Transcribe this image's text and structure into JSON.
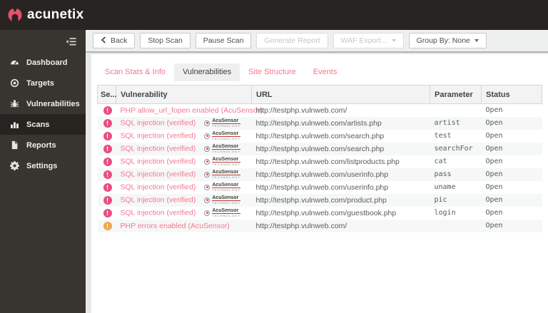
{
  "brand": {
    "logo_text": "acunetix"
  },
  "colors": {
    "accent_pink": "#e8506e",
    "link_pink": "#f2788f",
    "severity_high": "#e84d82",
    "severity_medium": "#eda54e"
  },
  "sidebar": {
    "items": [
      {
        "label": "Dashboard",
        "icon": "dashboard-icon",
        "active": false
      },
      {
        "label": "Targets",
        "icon": "targets-icon",
        "active": false
      },
      {
        "label": "Vulnerabilities",
        "icon": "vulnerabilities-icon",
        "active": false
      },
      {
        "label": "Scans",
        "icon": "scans-icon",
        "active": true
      },
      {
        "label": "Reports",
        "icon": "reports-icon",
        "active": false
      },
      {
        "label": "Settings",
        "icon": "settings-icon",
        "active": false
      }
    ]
  },
  "toolbar": {
    "buttons": [
      {
        "label": "Back",
        "icon": "back-chevron-icon",
        "disabled": false,
        "caret": false
      },
      {
        "label": "Stop Scan",
        "icon": "",
        "disabled": false,
        "caret": false
      },
      {
        "label": "Pause Scan",
        "icon": "",
        "disabled": false,
        "caret": false
      },
      {
        "label": "Generate Report",
        "icon": "",
        "disabled": true,
        "caret": false
      },
      {
        "label": "WAF Export...",
        "icon": "",
        "disabled": true,
        "caret": true
      },
      {
        "label": "Group By: None",
        "icon": "",
        "disabled": false,
        "caret": true
      }
    ]
  },
  "tabs": [
    {
      "label": "Scan Stats & Info",
      "active": false
    },
    {
      "label": "Vulnerabilities",
      "active": true
    },
    {
      "label": "Site Structure",
      "active": false
    },
    {
      "label": "Events",
      "active": false
    }
  ],
  "table": {
    "columns": [
      "Se...",
      "Vulnerability",
      "URL",
      "Parameter",
      "Status"
    ],
    "severity_glyph": "!",
    "acusensor_badge": {
      "title": "AcuSensor",
      "subtitle": "TECHNOLOGY"
    },
    "rows": [
      {
        "severity": "high",
        "name": "PHP allow_url_fopen enabled (AcuSensor)",
        "acusensor": false,
        "url": "http://testphp.vulnweb.com/",
        "parameter": "",
        "status": "Open"
      },
      {
        "severity": "high",
        "name": "SQL injection (verified)",
        "acusensor": true,
        "url": "http://testphp.vulnweb.com/artists.php",
        "parameter": "artist",
        "status": "Open"
      },
      {
        "severity": "high",
        "name": "SQL injection (verified)",
        "acusensor": true,
        "url": "http://testphp.vulnweb.com/search.php",
        "parameter": "test",
        "status": "Open"
      },
      {
        "severity": "high",
        "name": "SQL injection (verified)",
        "acusensor": true,
        "url": "http://testphp.vulnweb.com/search.php",
        "parameter": "searchFor",
        "status": "Open"
      },
      {
        "severity": "high",
        "name": "SQL injection (verified)",
        "acusensor": true,
        "url": "http://testphp.vulnweb.com/listproducts.php",
        "parameter": "cat",
        "status": "Open"
      },
      {
        "severity": "high",
        "name": "SQL injection (verified)",
        "acusensor": true,
        "url": "http://testphp.vulnweb.com/userinfo.php",
        "parameter": "pass",
        "status": "Open"
      },
      {
        "severity": "high",
        "name": "SQL injection (verified)",
        "acusensor": true,
        "url": "http://testphp.vulnweb.com/userinfo.php",
        "parameter": "uname",
        "status": "Open"
      },
      {
        "severity": "high",
        "name": "SQL injection (verified)",
        "acusensor": true,
        "url": "http://testphp.vulnweb.com/product.php",
        "parameter": "pic",
        "status": "Open"
      },
      {
        "severity": "high",
        "name": "SQL injection (verified)",
        "acusensor": true,
        "url": "http://testphp.vulnweb.com/guestbook.php",
        "parameter": "login",
        "status": "Open"
      },
      {
        "severity": "medium",
        "name": "PHP errors enabled (AcuSensor)",
        "acusensor": false,
        "url": "http://testphp.vulnweb.com/",
        "parameter": "",
        "status": "Open"
      }
    ]
  }
}
